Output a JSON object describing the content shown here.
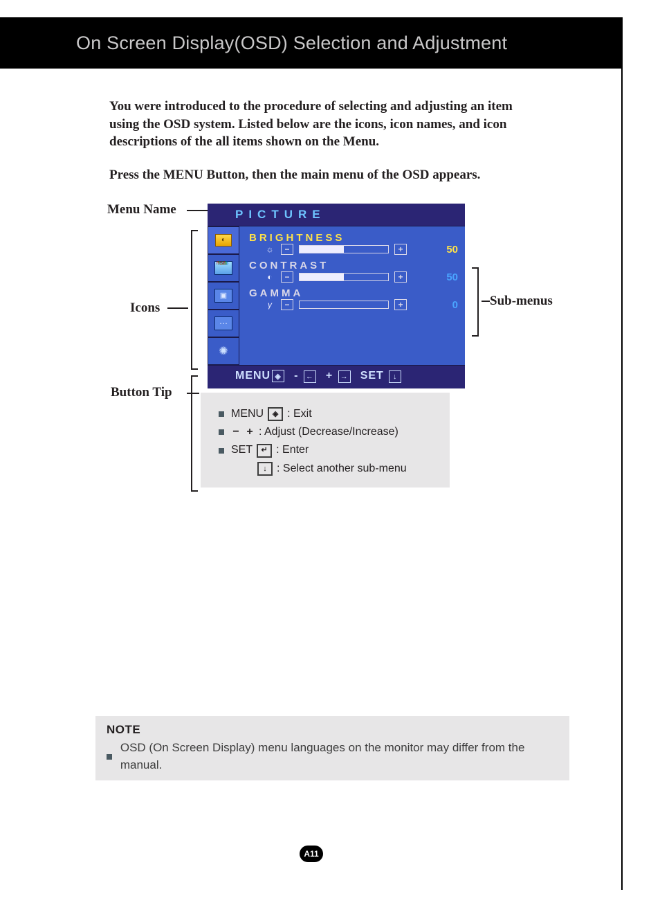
{
  "header": {
    "title": "On Screen Display(OSD) Selection and Adjustment"
  },
  "intro": {
    "p1": "You were introduced to the procedure of selecting and adjusting an item using the OSD system.  Listed below are the icons, icon names, and icon descriptions of the all items shown on the Menu.",
    "p2": "Press the MENU Button, then the main menu of the OSD appears."
  },
  "callouts": {
    "menu_name": "Menu Name",
    "icons": "Icons",
    "sub_menus": "Sub-menus",
    "button_tip": "Button Tip"
  },
  "osd": {
    "menu_title": "PICTURE",
    "subs": [
      {
        "label": "BRIGHTNESS",
        "value": "50",
        "selected": true,
        "icon": "☼"
      },
      {
        "label": "CONTRAST",
        "value": "50",
        "selected": false,
        "icon": "◐"
      },
      {
        "label": "GAMMA",
        "value": "0",
        "selected": false,
        "icon": "γ"
      }
    ],
    "footer": {
      "menu": "MENU",
      "minus": "-",
      "plus": "+",
      "set": "SET"
    }
  },
  "tips": {
    "menu_label": "MENU",
    "menu_desc": ": Exit",
    "adjust_minus": "−",
    "adjust_plus": "+",
    "adjust_desc": ": Adjust (Decrease/Increase)",
    "set_label": "SET",
    "set_desc": ": Enter",
    "down_desc": ": Select another sub-menu"
  },
  "note": {
    "title": "NOTE",
    "body": "OSD (On Screen Display) menu languages on the monitor may differ from the manual."
  },
  "page_number": "A11"
}
